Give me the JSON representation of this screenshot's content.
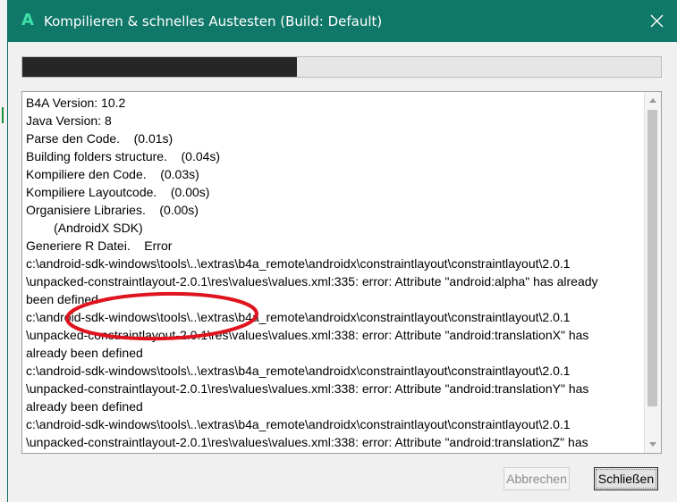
{
  "window": {
    "title": "Kompilieren & schnelles Austesten (Build: Default)",
    "app_icon": "b4a-logo-icon",
    "accent": "#107868"
  },
  "progress": {
    "fraction": 0.43
  },
  "log": {
    "lines": [
      "B4A Version: 10.2",
      "Java Version: 8",
      "Parse den Code.    (0.01s)",
      "Building folders structure.    (0.04s)",
      "Kompiliere den Code.    (0.03s)",
      "Kompiliere Layoutcode.    (0.00s)",
      "Organisiere Libraries.    (0.00s)",
      "        (AndroidX SDK)",
      "Generiere R Datei.    Error",
      "c:\\android-sdk-windows\\tools\\..\\extras\\b4a_remote\\androidx\\constraintlayout\\constraintlayout\\2.0.1",
      "\\unpacked-constraintlayout-2.0.1\\res\\values\\values.xml:335: error: Attribute \"android:alpha\" has already",
      "been defined",
      "c:\\android-sdk-windows\\tools\\..\\extras\\b4a_remote\\androidx\\constraintlayout\\constraintlayout\\2.0.1",
      "\\unpacked-constraintlayout-2.0.1\\res\\values\\values.xml:338: error: Attribute \"android:translationX\" has",
      "already been defined",
      "c:\\android-sdk-windows\\tools\\..\\extras\\b4a_remote\\androidx\\constraintlayout\\constraintlayout\\2.0.1",
      "\\unpacked-constraintlayout-2.0.1\\res\\values\\values.xml:338: error: Attribute \"android:translationY\" has",
      "already been defined",
      "c:\\android-sdk-windows\\tools\\..\\extras\\b4a_remote\\androidx\\constraintlayout\\constraintlayout\\2.0.1",
      "\\unpacked-constraintlayout-2.0.1\\res\\values\\values.xml:338: error: Attribute \"android:translationZ\" has"
    ],
    "annotation_color": "#e0141e"
  },
  "buttons": {
    "cancel": "Abbrechen",
    "close": "Schließen"
  },
  "icons": {
    "close": "close-icon",
    "scroll_up": "scroll-up-icon",
    "scroll_down": "scroll-down-icon"
  }
}
